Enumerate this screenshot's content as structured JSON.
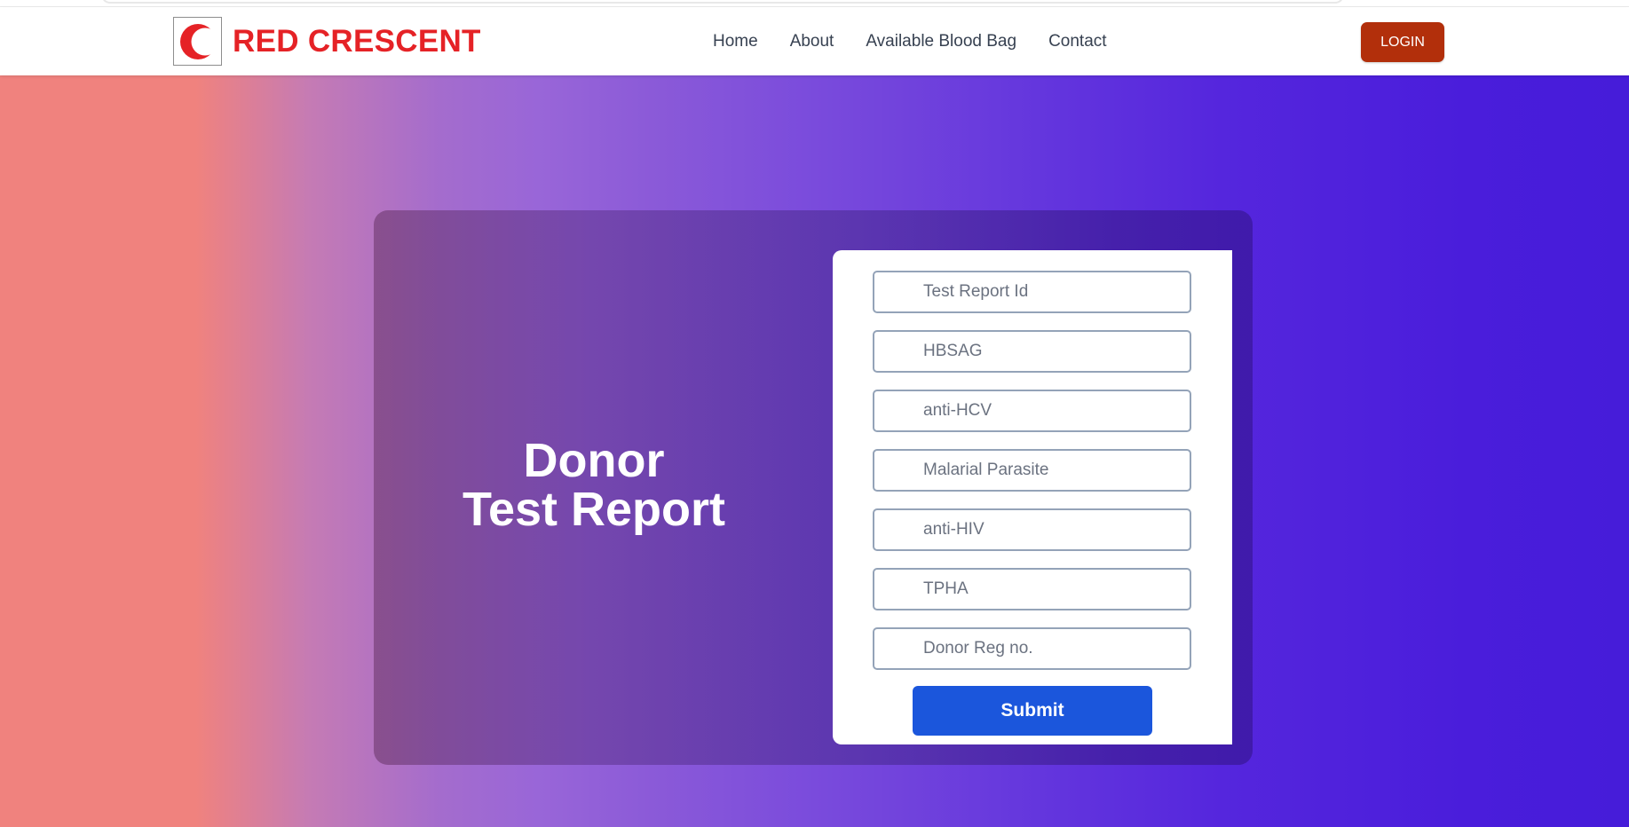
{
  "header": {
    "brand_name": "RED CRESCENT",
    "logo_icon": "red-crescent-logo-icon",
    "nav": [
      {
        "label": "Home"
      },
      {
        "label": "About"
      },
      {
        "label": "Available Blood Bag"
      },
      {
        "label": "Contact"
      }
    ],
    "login_label": "LOGIN"
  },
  "hero": {
    "title_line1": "Donor",
    "title_line2": "Test Report"
  },
  "form": {
    "fields": [
      {
        "name": "test-report-id-input",
        "placeholder": "Test Report Id",
        "value": ""
      },
      {
        "name": "hbsag-input",
        "placeholder": "HBSAG",
        "value": ""
      },
      {
        "name": "anti-hcv-input",
        "placeholder": "anti-HCV",
        "value": ""
      },
      {
        "name": "malarial-parasite-input",
        "placeholder": "Malarial Parasite",
        "value": ""
      },
      {
        "name": "anti-hiv-input",
        "placeholder": "anti-HIV",
        "value": ""
      },
      {
        "name": "tpha-input",
        "placeholder": "TPHA",
        "value": ""
      },
      {
        "name": "donor-reg-no-input",
        "placeholder": "Donor Reg no.",
        "value": ""
      }
    ],
    "submit_label": "Submit"
  },
  "colors": {
    "brand_red": "#e52226",
    "login_bg": "#b22f0b",
    "submit_bg": "#1b56dc",
    "gradient_start": "#f0827e",
    "gradient_end": "#461cd9"
  }
}
